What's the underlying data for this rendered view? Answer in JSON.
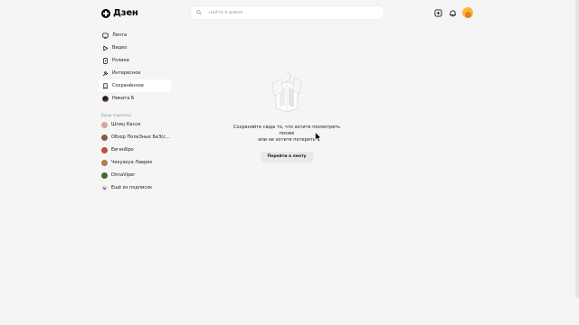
{
  "brand": {
    "name": "Дзен"
  },
  "search": {
    "placeholder": "найти в дзене"
  },
  "nav": {
    "items": [
      {
        "label": "Лента",
        "icon": "feed-icon"
      },
      {
        "label": "Видео",
        "icon": "video-icon"
      },
      {
        "label": "Ролики",
        "icon": "shorts-icon"
      },
      {
        "label": "Интересное",
        "icon": "interesting-icon"
      },
      {
        "label": "Сохранённое",
        "icon": "bookmark-icon"
      },
      {
        "label": "Никита Б",
        "icon": "profile-avatar"
      }
    ]
  },
  "subscriptions": {
    "title": "Ваши подписки",
    "items": [
      {
        "label": "Шпиц Касси",
        "color": "#d9a3a0"
      },
      {
        "label": "Обзор ПолеЗных БеЗ(с...",
        "color": "#8a5a44"
      },
      {
        "label": "ЕвгенБро",
        "color": "#c44a3a"
      },
      {
        "label": "Чихуахуа Лаврик",
        "color": "#b07a52"
      },
      {
        "label": "DimaViper",
        "color": "#3f6b2a"
      }
    ],
    "more_label": "Ещё из подписок"
  },
  "empty_state": {
    "line1": "Сохраняйте сюда то, что хотите посмотреть позже",
    "line2": "или не хотите потерять",
    "button_label": "Перейти в ленту"
  }
}
